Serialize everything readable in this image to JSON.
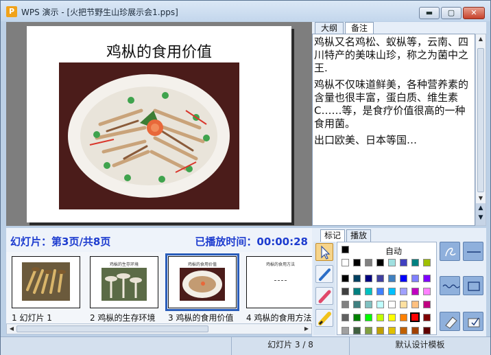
{
  "window": {
    "title": "WPS 演示 - [火把节野生山珍展示会1.pps]",
    "app_icon_letter": "P",
    "buttons": {
      "minimize": "▬",
      "maximize": "▢",
      "close": "✕"
    }
  },
  "slide": {
    "title": "鸡枞的食用价值"
  },
  "notes_tabs": [
    "大纲",
    "备注"
  ],
  "notes": {
    "paragraphs": [
      "鸡枞又名鸡松、蚁枞等，云南、四川特产的美味山珍，称之为菌中之王.",
      "鸡枞不仅味道鲜美，各种营养素的含量也很丰富，蛋白质、维生素C……等，是食疗价值很高的一种食用菌。",
      "出口欧美、日本等国…"
    ]
  },
  "info": {
    "slide_position": "幻灯片：第3页/共8页",
    "play_time": "已播放时间：00:00:28"
  },
  "thumbnails": [
    {
      "label": "1 幻灯片 1",
      "title": "",
      "selected": false
    },
    {
      "label": "2 鸡枞的生存环境",
      "title": "鸡枞的生存环境",
      "selected": false
    },
    {
      "label": "3 鸡枞的食用价值",
      "title": "鸡枞的食用价值",
      "selected": true
    },
    {
      "label": "4 鸡枞的食用方法",
      "title": "鸡枞的食用方法",
      "selected": false
    }
  ],
  "pen_tabs": [
    "标记",
    "播放"
  ],
  "palette": {
    "auto_label": "自动",
    "selected_color": "#ff0000"
  },
  "statusbar": {
    "slide_counter": "幻灯片 3 / 8",
    "template": "默认设计模板"
  }
}
